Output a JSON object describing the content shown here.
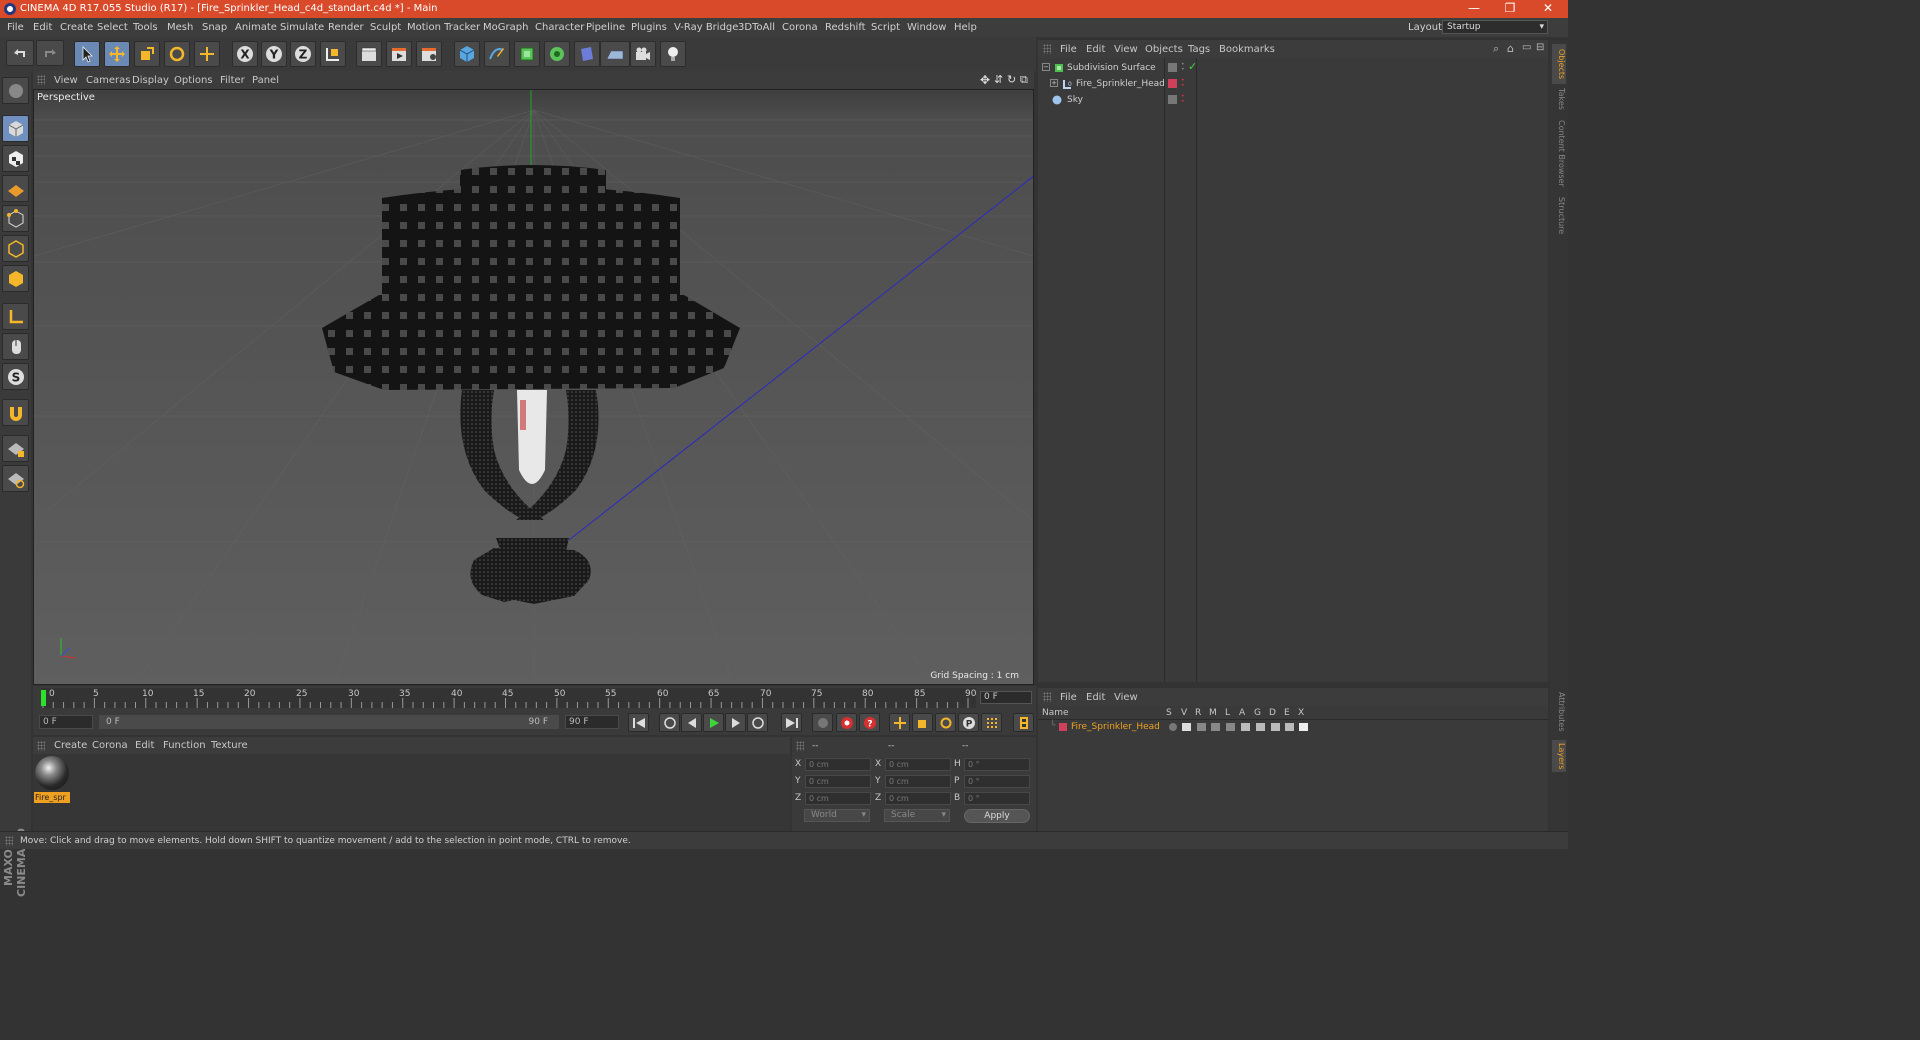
{
  "window": {
    "title": "CINEMA 4D R17.055 Studio (R17) - [Fire_Sprinkler_Head_c4d_standart.c4d *] - Main",
    "minimize": "—",
    "restore": "❐",
    "close": "✕"
  },
  "menu": [
    "File",
    "Edit",
    "Create",
    "Select",
    "Tools",
    "Mesh",
    "Snap",
    "Animate",
    "Simulate",
    "Render",
    "Sculpt",
    "Motion Tracker",
    "MoGraph",
    "Character",
    "Pipeline",
    "Plugins",
    "V-Ray Bridge",
    "3DToAll",
    "Corona",
    "Redshift",
    "Script",
    "Window",
    "Help"
  ],
  "layout": {
    "label": "Layout:",
    "value": "Startup"
  },
  "viewport": {
    "menu": [
      "View",
      "Cameras",
      "Display",
      "Options",
      "Filter",
      "Panel"
    ],
    "label": "Perspective",
    "grid_spacing": "Grid Spacing : 1 cm"
  },
  "timeline": {
    "ticks": [
      "0",
      "5",
      "10",
      "15",
      "20",
      "25",
      "30",
      "35",
      "40",
      "45",
      "50",
      "55",
      "60",
      "65",
      "70",
      "75",
      "80",
      "85",
      "90"
    ],
    "current_frame_field": "0 F",
    "start_field": "0 F",
    "range_start": "0 F",
    "range_end": "90 F",
    "end_field": "90 F"
  },
  "materials": {
    "menu": [
      "Create",
      "Corona",
      "Edit",
      "Function",
      "Texture"
    ],
    "items": [
      {
        "name": "Fire_spr"
      }
    ]
  },
  "coordinates": {
    "headers": [
      "--",
      "--",
      "--"
    ],
    "rows": [
      {
        "l1": "X",
        "v1": "0 cm",
        "l2": "X",
        "v2": "0 cm",
        "l3": "H",
        "v3": "0 °"
      },
      {
        "l1": "Y",
        "v1": "0 cm",
        "l2": "Y",
        "v2": "0 cm",
        "l3": "P",
        "v3": "0 °"
      },
      {
        "l1": "Z",
        "v1": "0 cm",
        "l2": "Z",
        "v2": "0 cm",
        "l3": "B",
        "v3": "0 °"
      }
    ],
    "mode1": "World",
    "mode2": "Scale",
    "apply": "Apply"
  },
  "objects": {
    "menu": [
      "File",
      "Edit",
      "View",
      "Objects",
      "Tags",
      "Bookmarks"
    ],
    "items": [
      {
        "name": "Subdivision Surface"
      },
      {
        "name": "Fire_Sprinkler_Head"
      },
      {
        "name": "Sky"
      }
    ]
  },
  "layers": {
    "menu": [
      "File",
      "Edit",
      "View"
    ],
    "header": {
      "name": "Name",
      "cols": [
        "S",
        "V",
        "R",
        "M",
        "L",
        "A",
        "G",
        "D",
        "E",
        "X"
      ]
    },
    "items": [
      {
        "name": "Fire_Sprinkler_Head"
      }
    ]
  },
  "right_tabs": [
    "Objects",
    "Takes",
    "Content Browser",
    "Structure",
    "Attributes",
    "Layers"
  ],
  "branding": "MAXON CINEMA 4D",
  "status": "Move: Click and drag to move elements. Hold down SHIFT to quantize movement / add to the selection in point mode, CTRL to remove.",
  "colors": {
    "titlebar": "#d94a2b",
    "accent": "#f0a020",
    "selection": "#6a89b5",
    "layer_color": "#d0405a"
  }
}
